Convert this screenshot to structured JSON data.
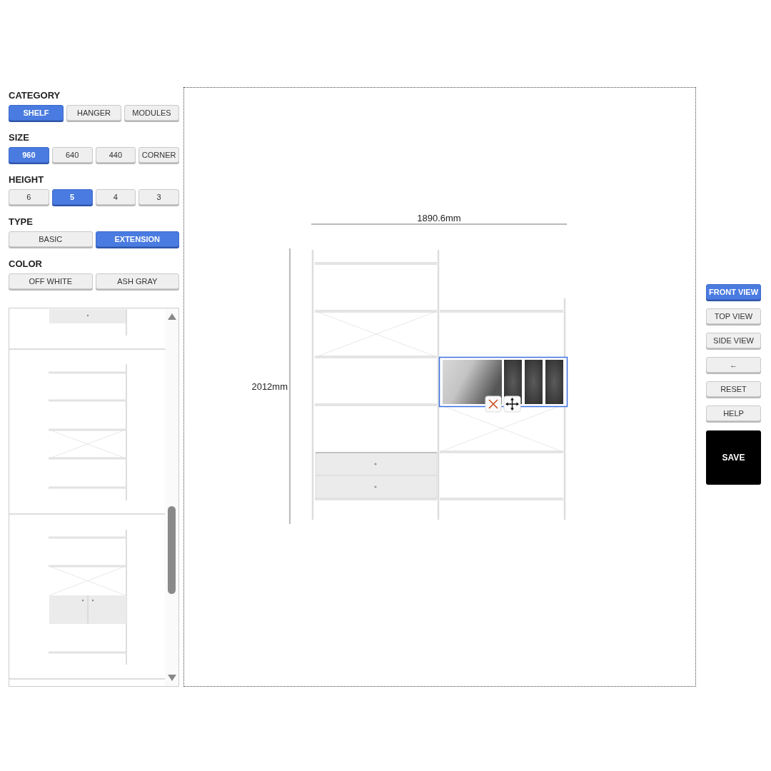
{
  "sections": [
    {
      "title": "CATEGORY",
      "options": [
        {
          "label": "SHELF",
          "selected": true
        },
        {
          "label": "HANGER",
          "selected": false
        },
        {
          "label": "MODULES",
          "selected": false
        }
      ]
    },
    {
      "title": "SIZE",
      "options": [
        {
          "label": "960",
          "selected": true
        },
        {
          "label": "640",
          "selected": false
        },
        {
          "label": "440",
          "selected": false
        },
        {
          "label": "CORNER",
          "selected": false
        }
      ]
    },
    {
      "title": "HEIGHT",
      "options": [
        {
          "label": "6",
          "selected": false
        },
        {
          "label": "5",
          "selected": true
        },
        {
          "label": "4",
          "selected": false
        },
        {
          "label": "3",
          "selected": false
        }
      ]
    },
    {
      "title": "TYPE",
      "options": [
        {
          "label": "BASIC",
          "selected": false
        },
        {
          "label": "EXTENSION",
          "selected": true
        }
      ]
    },
    {
      "title": "COLOR",
      "options": [
        {
          "label": "OFF WHITE",
          "selected": false
        },
        {
          "label": "ASH GRAY",
          "selected": false
        }
      ]
    }
  ],
  "module_list": {
    "items": [
      {
        "kind": "drawer"
      },
      {
        "kind": "braced-shelf"
      },
      {
        "kind": "cabinet"
      }
    ]
  },
  "canvas": {
    "width_label": "1890.6mm",
    "height_label": "2012mm"
  },
  "view_buttons": [
    {
      "label": "FRONT VIEW",
      "selected": true
    },
    {
      "label": "TOP VIEW",
      "selected": false
    },
    {
      "label": "SIDE VIEW",
      "selected": false
    }
  ],
  "tool_buttons": [
    "←",
    "RESET",
    "HELP"
  ],
  "save": "SAVE"
}
